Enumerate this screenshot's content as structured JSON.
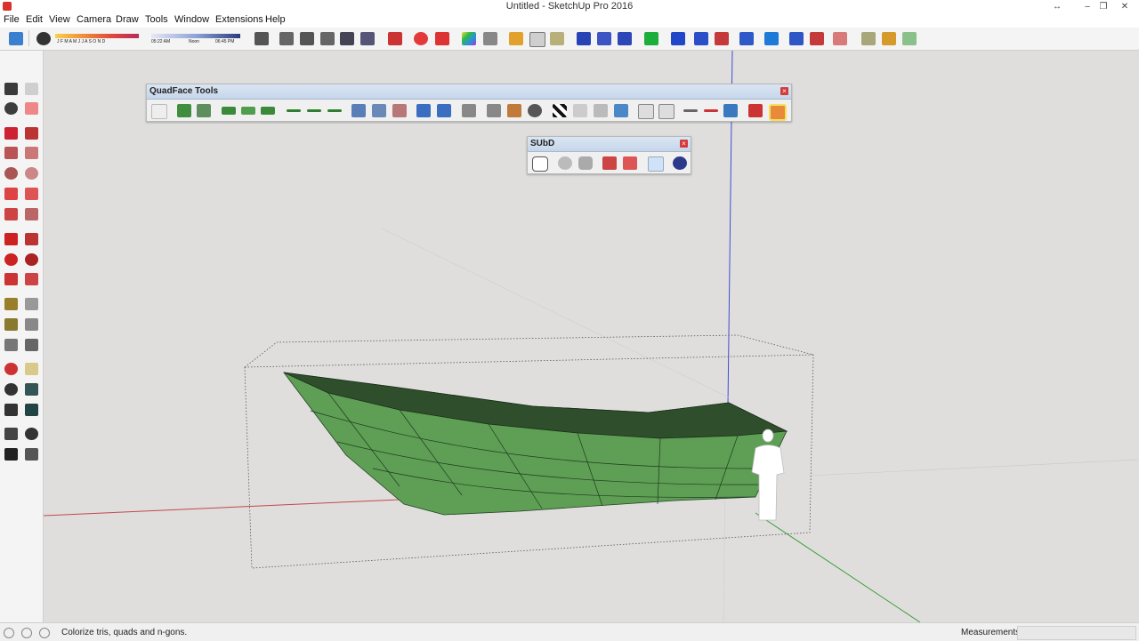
{
  "window": {
    "title": "Untitled - SketchUp Pro 2016"
  },
  "menu": [
    "File",
    "Edit",
    "View",
    "Camera",
    "Draw",
    "Tools",
    "Window",
    "Extensions",
    "Help"
  ],
  "shadows": {
    "months": "J F M A M J J A S O N D",
    "time_start": "05:22 AM",
    "time_mid": "Noon",
    "time_end": "06:45 PM"
  },
  "panels": {
    "quadface": {
      "title": "QuadFace Tools",
      "close": "×"
    },
    "subd": {
      "title": "SUbD",
      "close": "×"
    }
  },
  "status": {
    "message": "Colorize tris, quads and n-gons.",
    "measurements_label": "Measurements",
    "measurements_value": ""
  },
  "colors": {
    "boat_side": "#5e9e55",
    "boat_top": "#2f4e2b",
    "accent_red": "#d43b3b",
    "axis_red": "#c24848",
    "axis_green": "#3b9f3b",
    "axis_blue": "#3c4ed0"
  }
}
